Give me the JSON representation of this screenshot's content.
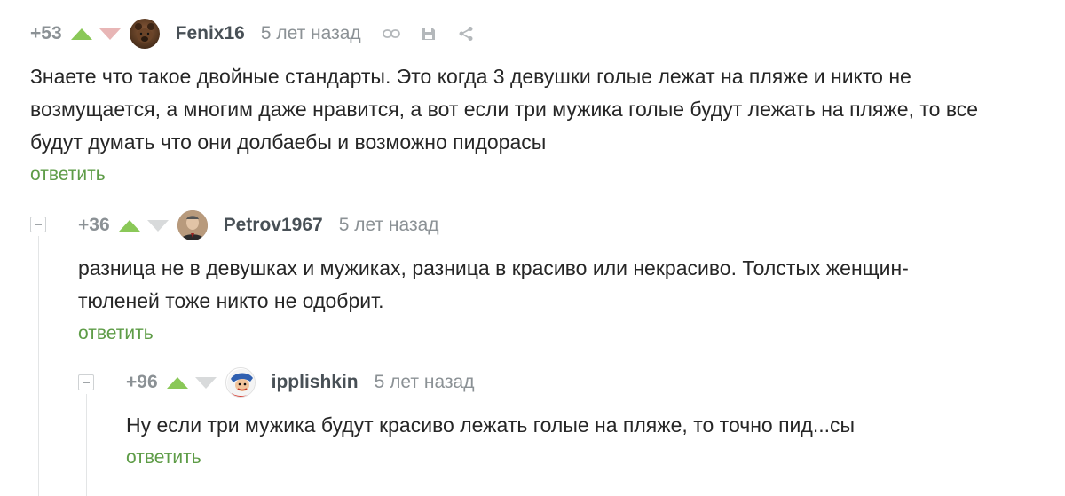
{
  "comments": [
    {
      "rating": "+53",
      "username": "Fenix16",
      "time": "5 лет назад",
      "text": "Знаете что такое двойные стандарты. Это когда 3 девушки голые лежат на пляже и никто не возмущается, а многим даже нравится, а вот если три мужика голые будут лежать на пляже, то все будут думать что они долбаебы и возможно пидорасы",
      "reply": "ответить"
    },
    {
      "rating": "+36",
      "username": "Petrov1967",
      "time": "5 лет назад",
      "text": "разница не в девушках и мужиках, разница в красиво или некрасиво. Толстых женщин-тюленей тоже никто не одобрит.",
      "reply": "ответить"
    },
    {
      "rating": "+96",
      "username": "ipplishkin",
      "time": "5 лет назад",
      "text": "Ну если три мужика будут красиво лежать голые на пляже, то точно пид...сы",
      "reply": "ответить"
    }
  ],
  "icons": [
    "link-icon",
    "save-icon",
    "share-icon",
    "collapse-icon"
  ],
  "colors": {
    "upvote": "#8ac858",
    "downvote": "#d8dadb",
    "downvote_active": "#e8b6b6",
    "reply": "#5e9c47",
    "meta": "#8b9195"
  }
}
